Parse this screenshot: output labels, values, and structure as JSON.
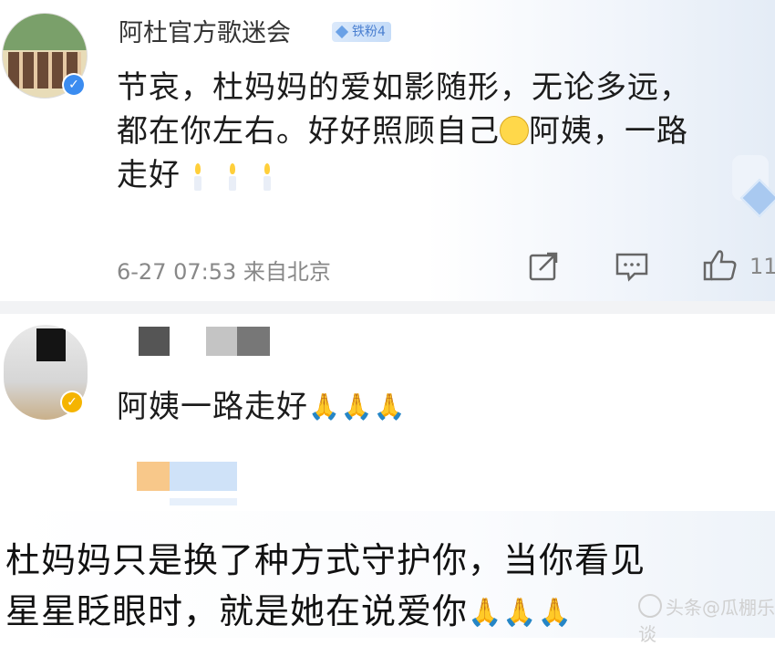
{
  "post": {
    "author": "阿杜官方歌迷会",
    "fan_badge": "铁粉4",
    "text_line1": "节哀，杜妈妈的爱如影随形，无论多远，",
    "text_line2a": "都在你左右。好好照顾自己",
    "text_line2b": "阿姨，一路",
    "text_line3": "走好",
    "timestamp": "6-27 07:53 来自北京",
    "like_count": "11",
    "icons": [
      "share-icon",
      "comment-icon",
      "like-icon"
    ]
  },
  "reply": {
    "text": "阿姨一路走好"
  },
  "bottom": {
    "line1": "杜妈妈只是换了种方式守护你，当你看见",
    "line2": "星星眨眼时，就是她在说爱你"
  },
  "watermark": "头条@瓜棚乐谈",
  "colors": {
    "verified_blue": "#3b8cf0",
    "verified_yellow": "#f5b400",
    "fan_badge_text": "#4a7fd0"
  }
}
